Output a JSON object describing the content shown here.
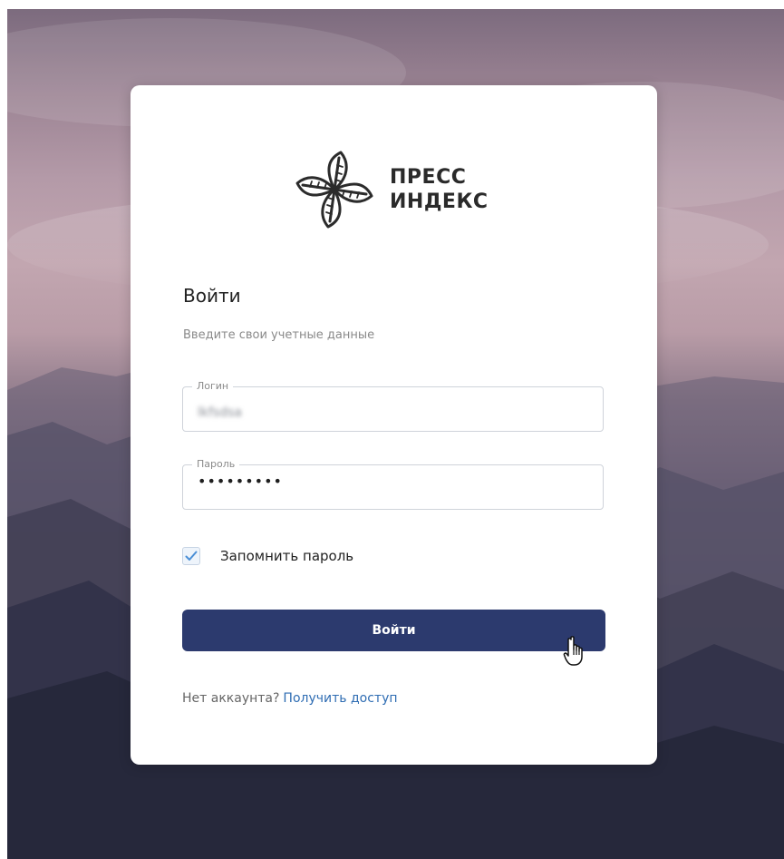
{
  "brand": {
    "logo_line1": "ПРЕСС",
    "logo_line2": "ИНДЕКС"
  },
  "form": {
    "title": "Войти",
    "subtitle": "Введите свои учетные данные",
    "login": {
      "label": "Логин",
      "value": "lkfsdsa"
    },
    "password": {
      "label": "Пароль",
      "value": "•••••••••"
    },
    "remember": {
      "label": "Запомнить пароль",
      "checked": true
    },
    "submit_label": "Войти"
  },
  "footer": {
    "no_account_text": "Нет аккаунта?",
    "get_access_link": "Получить доступ"
  },
  "colors": {
    "button": "#2c3a6e",
    "link": "#2f6db3",
    "checkbox_check": "#4a8fd6"
  },
  "icons": {
    "logo": "leaf-pinwheel-logo-icon",
    "check": "check-icon",
    "cursor": "hand-pointer-cursor-icon"
  }
}
